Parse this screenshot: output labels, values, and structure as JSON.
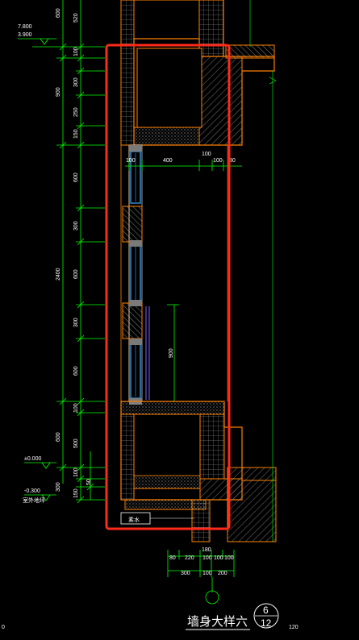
{
  "drawing": {
    "title": "墙身大样六",
    "detail_number": "6",
    "sheet_number": "12",
    "bottom_left_mark": "0",
    "bottom_right_mark": "120",
    "floor_note": "素水"
  },
  "elevations": {
    "top_level_1": "7.800",
    "top_level_2": "3.900",
    "ground_level": "±0.000",
    "outdoor_level": "-0.300",
    "outdoor_label": "室外地坪"
  },
  "left_dims": {
    "outer": [
      "900",
      "2400",
      "600"
    ],
    "inner": [
      "600",
      "520",
      "100",
      "300",
      "250",
      "150",
      "600",
      "300",
      "600",
      "300",
      "600",
      "100",
      "500",
      "100",
      "50",
      "150"
    ],
    "small": [
      "300"
    ]
  },
  "window_dims": {
    "top_row": [
      "100",
      "400",
      "100",
      "100",
      "80"
    ],
    "rail_height": "900"
  },
  "bottom_dims": {
    "row1": [
      "80",
      "220",
      "100",
      "100",
      "100"
    ],
    "row1b": "180",
    "row2": [
      "300",
      "100",
      "200"
    ]
  },
  "colors": {
    "background": "#000000",
    "wall": "#ff8000",
    "hatch": "#d9d9d9",
    "dimension": "#00ff00",
    "glass": "#3fa9ff",
    "highlight": "#ff2a1a",
    "text": "#ffffff",
    "rail": "#8060ff"
  }
}
